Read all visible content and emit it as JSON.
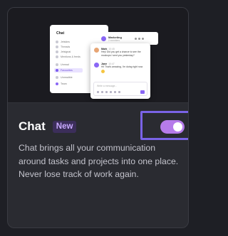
{
  "preview": {
    "back_window": {
      "title": "Chat",
      "nav_items": [
        {
          "label": "Jetskins"
        },
        {
          "label": "Threads"
        },
        {
          "label": "Jetsignal"
        },
        {
          "label": "Mentions & feeds"
        },
        {
          "label": "Unread"
        },
        {
          "label": "Favourites"
        },
        {
          "label": "Unreadble"
        },
        {
          "label": "Team"
        }
      ],
      "header_name": "Marketing",
      "header_sub": "2 members"
    },
    "messages": [
      {
        "name": "Mark",
        "time": "10:45",
        "text": "Hey! Did you get a chance to see the mockups I sent you yesterday?",
        "avatar_color": "#e7a574"
      },
      {
        "name": "Jane",
        "time": "10:47",
        "text": "Hi! That's amazing, I'm doing right now",
        "avatar_color": "#8a67f5",
        "emoji": true
      }
    ],
    "composer_placeholder": "Write a message..."
  },
  "feature": {
    "title": "Chat",
    "badge": "New",
    "toggle_on": true,
    "description": "Chat brings all your communication around tasks and projects into one place. Never lose track of work again."
  },
  "colors": {
    "background": "#1e1f25",
    "card": "#2a2b31",
    "accent_toggle": "#b67bea",
    "highlight_frame": "#7a63e6",
    "badge_text": "#c8a9ff",
    "badge_bg": "#3c2e5a"
  }
}
